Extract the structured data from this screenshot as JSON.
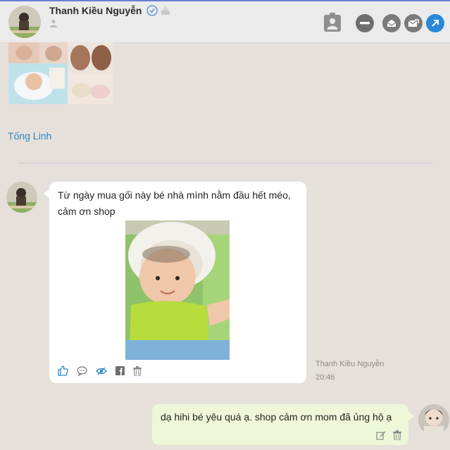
{
  "header": {
    "contact_name": "Thanh Kiều Nguyễn"
  },
  "thread": {
    "previous_sender": "Tống Linh"
  },
  "incoming": {
    "text": "Từ ngày mua gối này bé nhà mình nằm đầu hết méo, cảm ơn shop",
    "sender": "Thanh Kiều Nguyễn",
    "time": "20:46"
  },
  "outgoing": {
    "text": "dạ hihi bé yêu quá ạ. shop cảm ơn mom đã ủng hộ ạ"
  },
  "colors": {
    "accent_blue": "#2a87c8",
    "outgoing_bubble": "#eef8d8",
    "background": "#e6e0da",
    "header_bg": "#ecebeb"
  }
}
